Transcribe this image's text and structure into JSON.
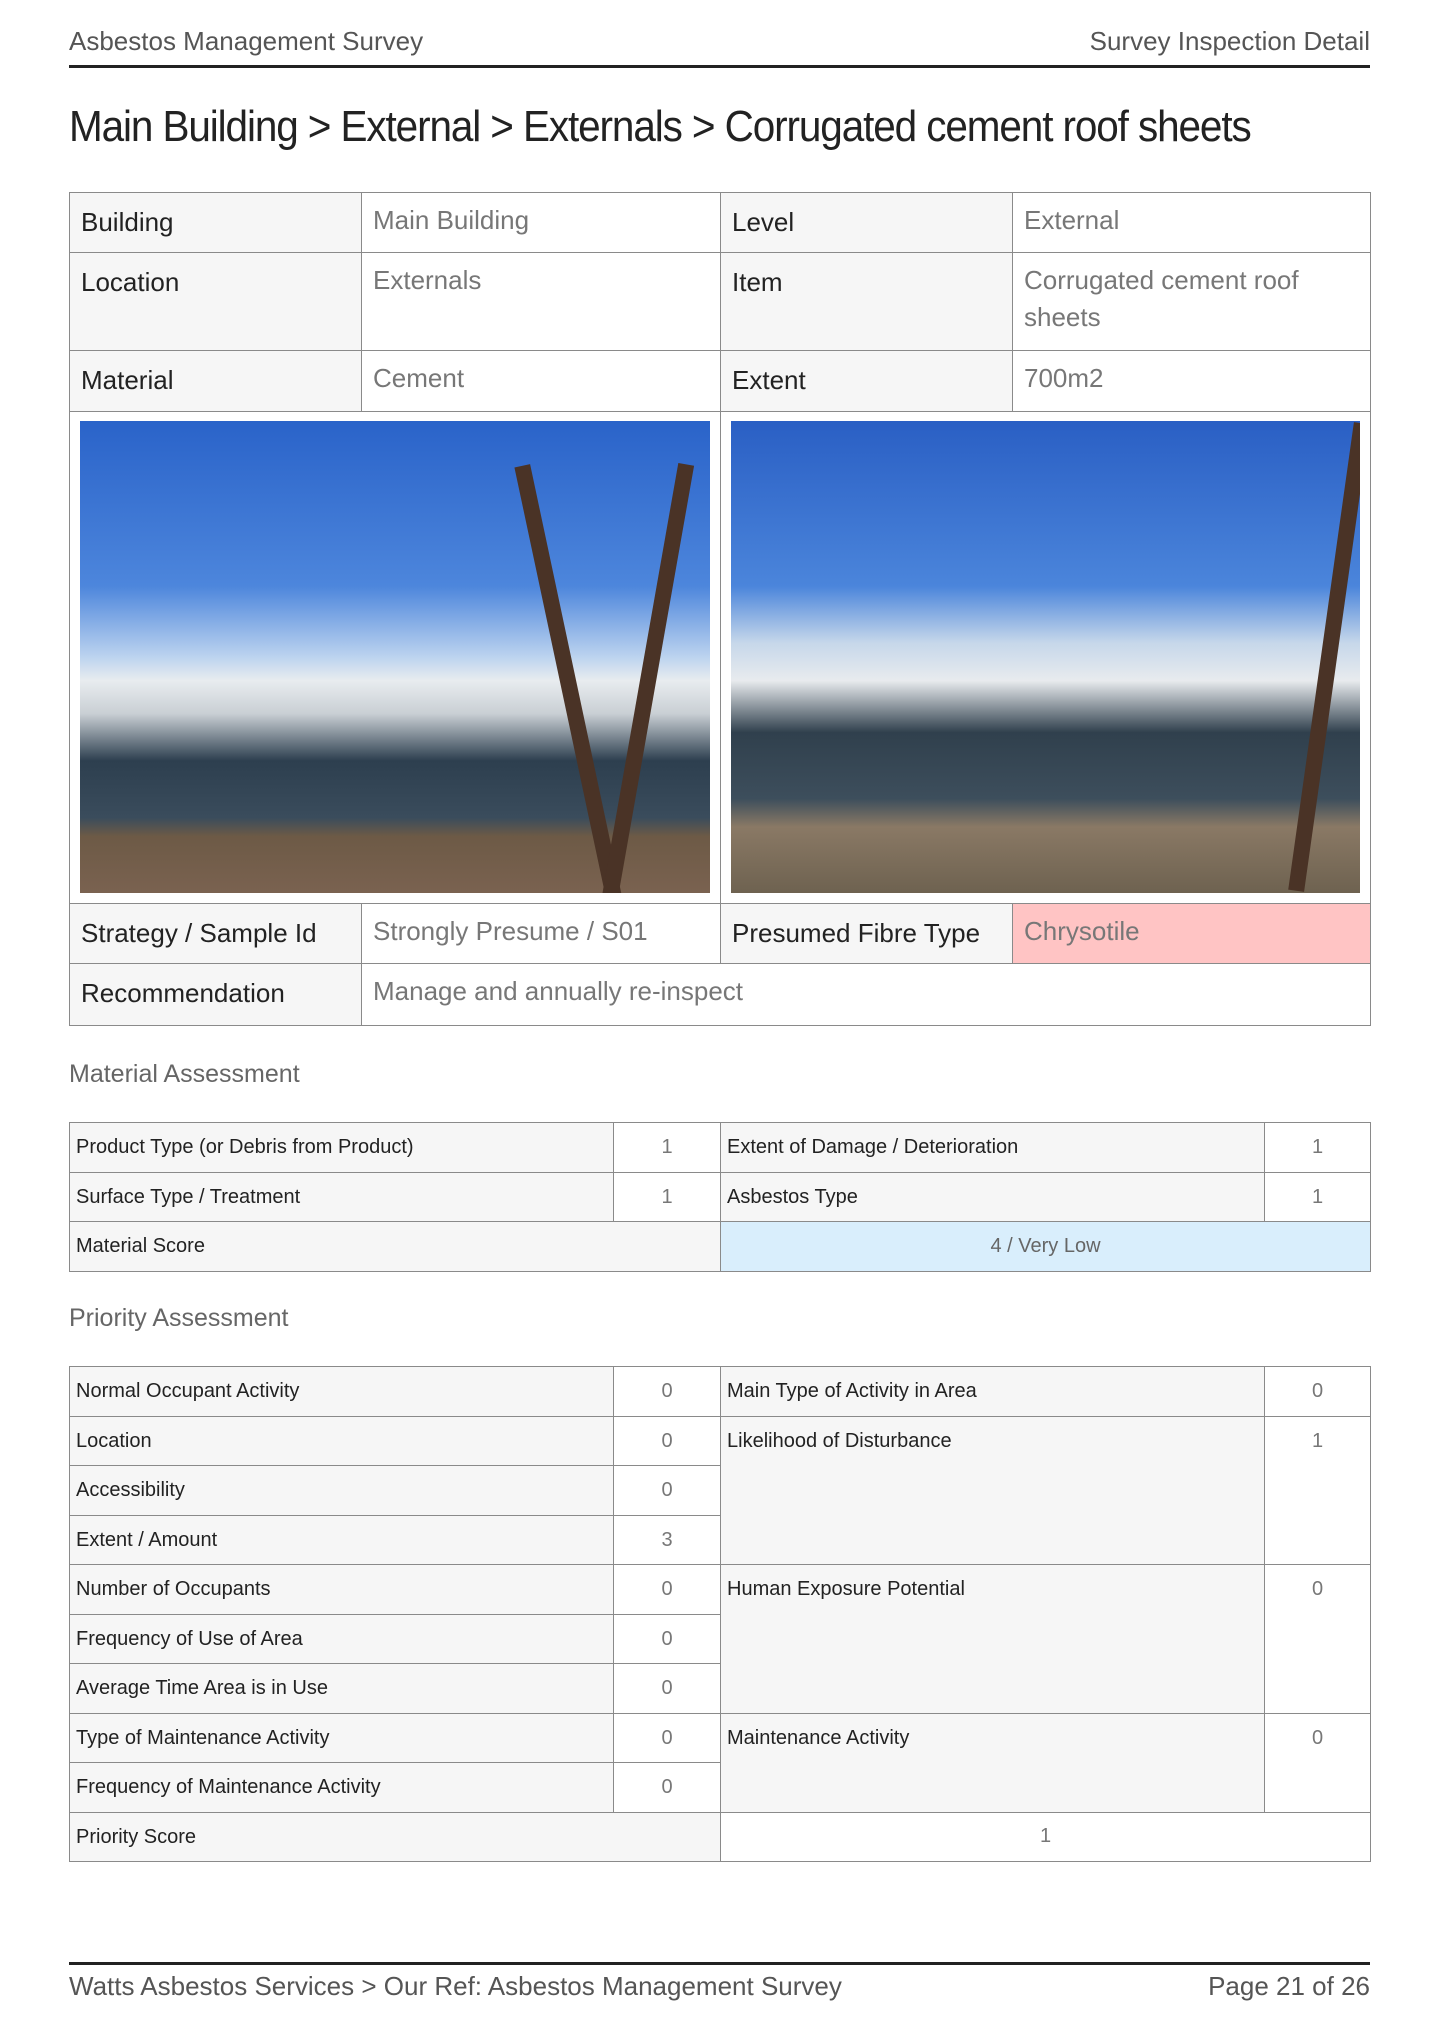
{
  "header": {
    "left": "Asbestos Management Survey",
    "right": "Survey Inspection Detail"
  },
  "title": "Main Building > External > Externals > Corrugated cement roof sheets",
  "details": {
    "building_label": "Building",
    "building": "Main Building",
    "level_label": "Level",
    "level": "External",
    "location_label": "Location",
    "location": "Externals",
    "item_label": "Item",
    "item": "Corrugated cement roof sheets",
    "material_label": "Material",
    "material": "Cement",
    "extent_label": "Extent",
    "extent": "700m2",
    "strategy_label": "Strategy / Sample Id",
    "strategy": "Strongly Presume / S01",
    "fibre_label": "Presumed Fibre Type",
    "fibre": "Chrysotile",
    "recommendation_label": "Recommendation",
    "recommendation": "Manage and annually re-inspect"
  },
  "material_assessment": {
    "title": "Material Assessment",
    "rows": [
      {
        "label": "Product Type (or Debris from Product)",
        "value": "1",
        "label2": "Extent of Damage / Deterioration",
        "value2": "1"
      },
      {
        "label": "Surface Type / Treatment",
        "value": "1",
        "label2": "Asbestos Type",
        "value2": "1"
      }
    ],
    "score_label": "Material Score",
    "score": "4 / Very Low"
  },
  "priority_assessment": {
    "title": "Priority Assessment",
    "left": [
      {
        "label": "Normal Occupant Activity",
        "value": "0"
      },
      {
        "label": "Location",
        "value": "0"
      },
      {
        "label": "Accessibility",
        "value": "0"
      },
      {
        "label": "Extent / Amount",
        "value": "3"
      },
      {
        "label": "Number of Occupants",
        "value": "0"
      },
      {
        "label": "Frequency of Use of Area",
        "value": "0"
      },
      {
        "label": "Average Time Area is in Use",
        "value": "0"
      },
      {
        "label": "Type of Maintenance Activity",
        "value": "0"
      },
      {
        "label": "Frequency of Maintenance Activity",
        "value": "0"
      }
    ],
    "right": [
      {
        "label": "Main Type of Activity in Area",
        "value": "0"
      },
      {
        "label": "Likelihood of Disturbance",
        "value": "1"
      },
      {
        "label": "Human Exposure Potential",
        "value": "0"
      },
      {
        "label": "Maintenance Activity",
        "value": "0"
      }
    ],
    "score_label": "Priority Score",
    "score": "1"
  },
  "footer": {
    "left": "Watts Asbestos Services > Our Ref: Asbestos Management Survey",
    "right": "Page 21 of 26"
  }
}
